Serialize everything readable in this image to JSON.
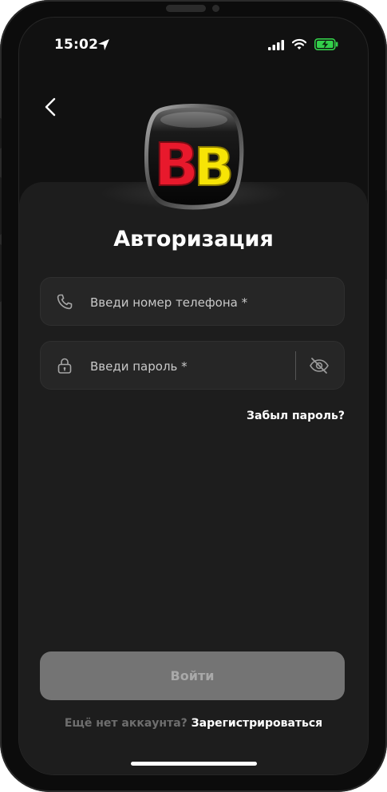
{
  "status_bar": {
    "time": "15:02",
    "location_icon": "location-arrow-icon",
    "signal_icon": "cellular-signal-icon",
    "wifi_icon": "wifi-icon",
    "battery_icon": "battery-charging-icon"
  },
  "header": {
    "back_icon": "chevron-left-icon",
    "logo_text": "BB"
  },
  "form": {
    "title": "Авторизация",
    "phone": {
      "placeholder": "Введи номер телефона *",
      "value": "",
      "icon": "phone-icon"
    },
    "password": {
      "placeholder": "Введи пароль *",
      "value": "",
      "icon": "lock-icon",
      "toggle_icon": "eye-off-icon"
    },
    "forgot_label": "Забыл пароль?",
    "submit_label": "Войти",
    "signup_question": "Ещё нет аккаунта?",
    "signup_link": "Зарегистрироваться"
  },
  "colors": {
    "screen_bg": "#111111",
    "card_bg": "#1d1d1d",
    "field_bg": "#262626",
    "button_disabled_bg": "#747474",
    "logo_red": "#e8192c",
    "logo_yellow": "#f7e406",
    "battery_green": "#33d04a"
  }
}
